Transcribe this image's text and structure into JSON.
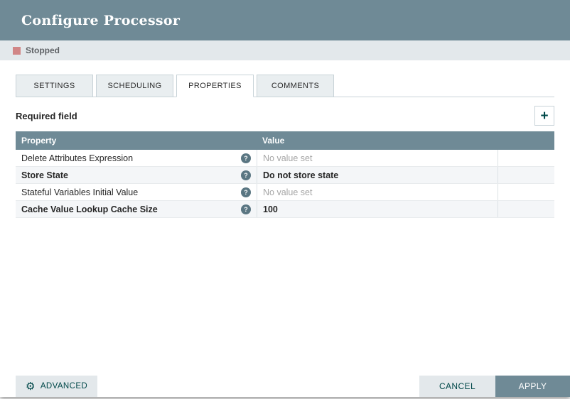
{
  "dialog": {
    "title": "Configure Processor"
  },
  "status": {
    "label": "Stopped"
  },
  "tabs": [
    {
      "label": "SETTINGS",
      "active": false
    },
    {
      "label": "SCHEDULING",
      "active": false
    },
    {
      "label": "PROPERTIES",
      "active": true
    },
    {
      "label": "COMMENTS",
      "active": false
    }
  ],
  "properties_panel": {
    "required_field_label": "Required field",
    "table": {
      "columns": [
        "Property",
        "Value"
      ],
      "rows": [
        {
          "property": "Delete Attributes Expression",
          "value": "No value set",
          "required": false,
          "value_set": false
        },
        {
          "property": "Store State",
          "value": "Do not store state",
          "required": true,
          "value_set": true
        },
        {
          "property": "Stateful Variables Initial Value",
          "value": "No value set",
          "required": false,
          "value_set": false
        },
        {
          "property": "Cache Value Lookup Cache Size",
          "value": "100",
          "required": true,
          "value_set": true
        }
      ]
    }
  },
  "footer": {
    "advanced_label": "ADVANCED",
    "cancel_label": "CANCEL",
    "apply_label": "APPLY"
  },
  "icons": {
    "plus": "+",
    "help": "?",
    "gear": "⚙"
  },
  "colors": {
    "header_bg": "#6f8a96",
    "status_bar_bg": "#e3e8eb",
    "stopped_icon": "#d18686",
    "table_header_bg": "#6f8a96",
    "apply_button_bg": "#6f8a96",
    "button_text": "#004849",
    "unset_value_text": "#a5a5a5"
  }
}
